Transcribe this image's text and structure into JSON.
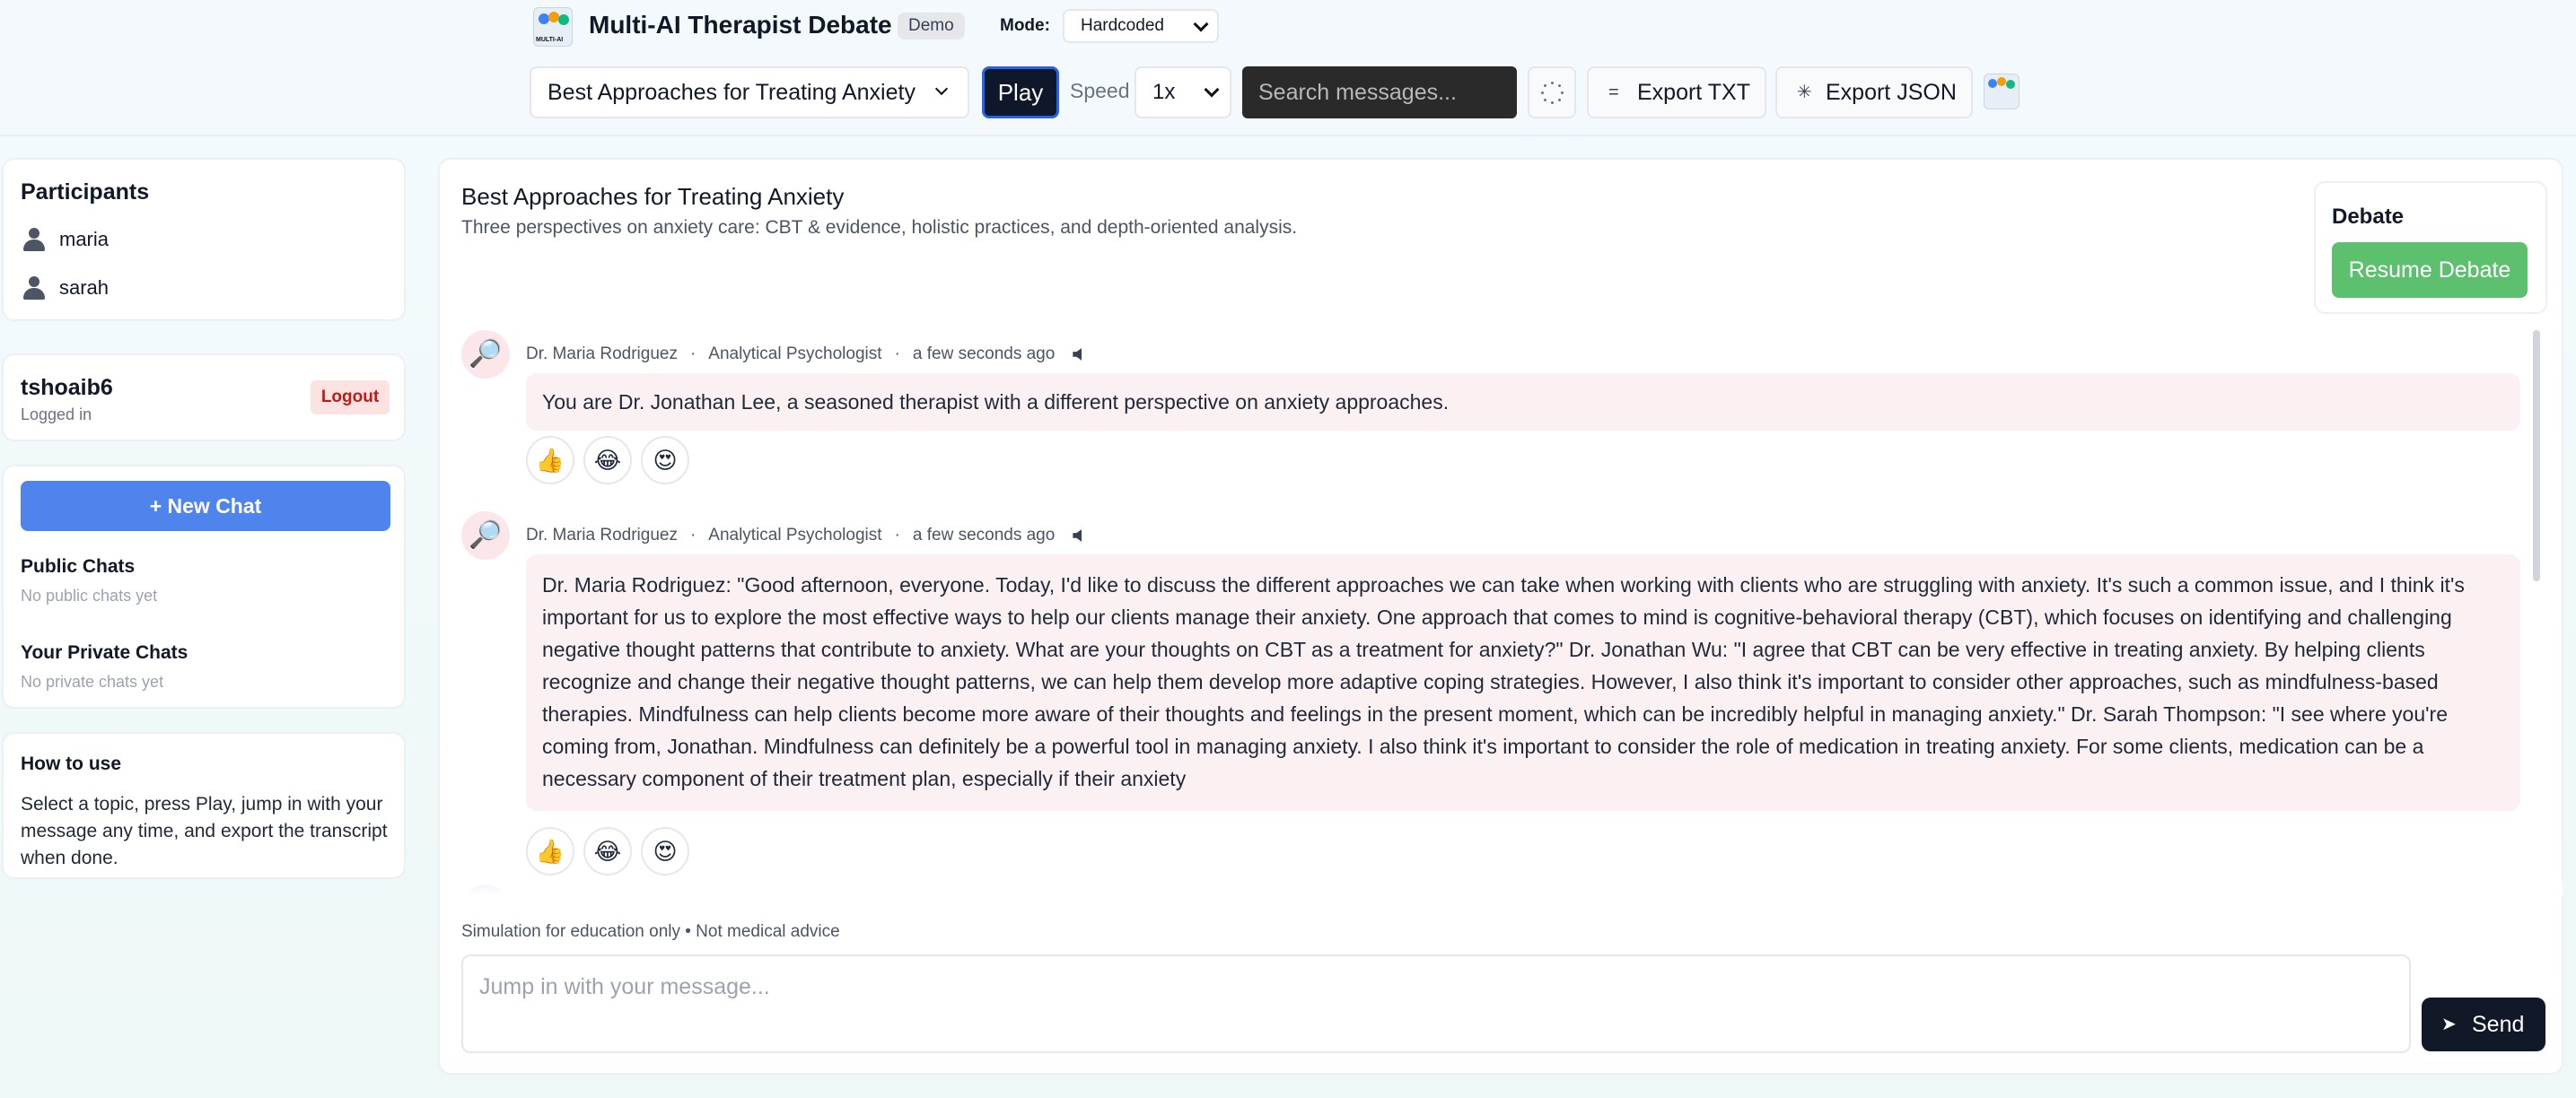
{
  "header": {
    "app_title": "Multi-AI Therapist Debate",
    "badge": "Demo",
    "logo_text": "MULTI-AI",
    "mode_label": "Mode:",
    "mode_value": "Hardcoded",
    "topic_value": "Best Approaches for Treating Anxiety",
    "play_label": "Play",
    "speed_label": "Speed",
    "speed_value": "1x",
    "search_placeholder": "Search messages...",
    "export_txt_label": "Export TXT",
    "export_json_label": "Export JSON"
  },
  "sidebar": {
    "participants_title": "Participants",
    "participants": [
      {
        "name": "maria"
      },
      {
        "name": "sarah"
      }
    ],
    "user": {
      "name": "tshoaib6",
      "status": "Logged in",
      "logout_label": "Logout"
    },
    "new_chat_label": "+ New Chat",
    "public_chats_title": "Public Chats",
    "public_chats_empty": "No public chats yet",
    "private_chats_title": "Your Private Chats",
    "private_chats_empty": "No private chats yet",
    "howto_title": "How to use",
    "howto_text": "Select a topic, press Play, jump in with your message any time, and export the transcript when done."
  },
  "main": {
    "title": "Best Approaches for Treating Anxiety",
    "subtitle": "Three perspectives on anxiety care: CBT & evidence, holistic practices, and depth-oriented analysis.",
    "debate_title": "Debate",
    "resume_label": "Resume Debate",
    "messages": [
      {
        "author": "Dr. Maria Rodriguez",
        "role": "Analytical Psychologist",
        "time": "a few seconds ago",
        "text": "You are Dr. Jonathan Lee, a seasoned therapist with a different perspective on anxiety approaches.",
        "reactions": [
          "👍",
          "😂",
          "😍"
        ]
      },
      {
        "author": "Dr. Maria Rodriguez",
        "role": "Analytical Psychologist",
        "time": "a few seconds ago",
        "text": "Dr. Maria Rodriguez: \"Good afternoon, everyone. Today, I'd like to discuss the different approaches we can take when working with clients who are struggling with anxiety. It's such a common issue, and I think it's important for us to explore the most effective ways to help our clients manage their anxiety. One approach that comes to mind is cognitive-behavioral therapy (CBT), which focuses on identifying and challenging negative thought patterns that contribute to anxiety. What are your thoughts on CBT as a treatment for anxiety?\" Dr. Jonathan Wu: \"I agree that CBT can be very effective in treating anxiety. By helping clients recognize and change their negative thought patterns, we can help them develop more adaptive coping strategies. However, I also think it's important to consider other approaches, such as mindfulness-based therapies. Mindfulness can help clients become more aware of their thoughts and feelings in the present moment, which can be incredibly helpful in managing anxiety.\" Dr. Sarah Thompson: \"I see where you're coming from, Jonathan. Mindfulness can definitely be a powerful tool in managing anxiety. I also think it's important to consider the role of medication in treating anxiety. For some clients, medication can be a necessary component of their treatment plan, especially if their anxiety",
        "reactions": [
          "👍",
          "😂",
          "😍"
        ]
      }
    ],
    "disclaimer": "Simulation for education only • Not medical advice",
    "input_placeholder": "Jump in with your message...",
    "send_label": "Send"
  },
  "icons": {
    "avatar": "magnifier-icon",
    "speaker": "speaker-icon",
    "send": "send-arrow-icon",
    "export_txt": "lines-icon",
    "export_json": "sparkle-icon",
    "loader": "spinner-icon",
    "person": "person-icon"
  },
  "colors": {
    "accent_blue": "#4f84ec",
    "resume_green": "#5dc06f",
    "logout_red": "#b91c1c",
    "bubble_bg": "#fbf1f3",
    "dark_button": "#111827"
  }
}
